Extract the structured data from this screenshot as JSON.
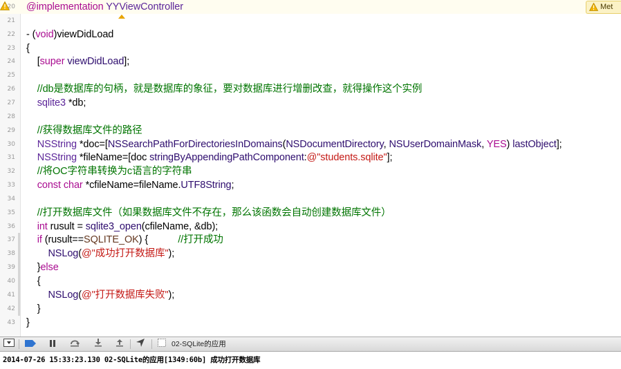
{
  "editor": {
    "issue_badge": {
      "text": "Met",
      "icon": "warning-icon"
    },
    "lines": [
      {
        "n": "20",
        "t": [
          {
            "c": "kw",
            "s": "@implementation"
          },
          {
            "c": "",
            "s": " "
          },
          {
            "c": "ty",
            "s": "YYViewController"
          }
        ]
      },
      {
        "n": "21",
        "t": []
      },
      {
        "n": "22",
        "t": [
          {
            "c": "",
            "s": "- ("
          },
          {
            "c": "kw",
            "s": "void"
          },
          {
            "c": "",
            "s": ")viewDidLoad"
          }
        ]
      },
      {
        "n": "23",
        "t": [
          {
            "c": "",
            "s": "{"
          }
        ]
      },
      {
        "n": "24",
        "t": [
          {
            "c": "",
            "s": "    ["
          },
          {
            "c": "kw",
            "s": "super"
          },
          {
            "c": "",
            "s": " "
          },
          {
            "c": "fn",
            "s": "viewDidLoad"
          },
          {
            "c": "",
            "s": "];"
          }
        ]
      },
      {
        "n": "25",
        "t": []
      },
      {
        "n": "26",
        "t": [
          {
            "c": "cm",
            "s": "    //db是数据库的句柄，就是数据库的象征，要对数据库进行增删改查，就得操作这个实例"
          }
        ]
      },
      {
        "n": "27",
        "t": [
          {
            "c": "",
            "s": "    "
          },
          {
            "c": "ty",
            "s": "sqlite3"
          },
          {
            "c": "",
            "s": " *db;"
          }
        ]
      },
      {
        "n": "28",
        "t": []
      },
      {
        "n": "29",
        "t": [
          {
            "c": "cm",
            "s": "    //获得数据库文件的路径"
          }
        ]
      },
      {
        "n": "30",
        "t": [
          {
            "c": "",
            "s": "    "
          },
          {
            "c": "ty",
            "s": "NSString"
          },
          {
            "c": "",
            "s": " *doc=["
          },
          {
            "c": "fn",
            "s": "NSSearchPathForDirectoriesInDomains"
          },
          {
            "c": "",
            "s": "("
          },
          {
            "c": "fn",
            "s": "NSDocumentDirectory"
          },
          {
            "c": "",
            "s": ", "
          },
          {
            "c": "fn",
            "s": "NSUserDomainMask"
          },
          {
            "c": "",
            "s": ", "
          },
          {
            "c": "kw",
            "s": "YES"
          },
          {
            "c": "",
            "s": ") "
          },
          {
            "c": "fn",
            "s": "lastObject"
          },
          {
            "c": "",
            "s": "];"
          }
        ]
      },
      {
        "n": "31",
        "t": [
          {
            "c": "",
            "s": "    "
          },
          {
            "c": "ty",
            "s": "NSString"
          },
          {
            "c": "",
            "s": " *fileName=[doc "
          },
          {
            "c": "fn",
            "s": "stringByAppendingPathComponent"
          },
          {
            "c": "",
            "s": ":"
          },
          {
            "c": "st",
            "s": "@\"students.sqlite\""
          },
          {
            "c": "",
            "s": "];"
          }
        ]
      },
      {
        "n": "32",
        "t": [
          {
            "c": "cm",
            "s": "    //将OC字符串转换为c语言的字符串"
          }
        ]
      },
      {
        "n": "33",
        "t": [
          {
            "c": "",
            "s": "    "
          },
          {
            "c": "kw",
            "s": "const"
          },
          {
            "c": "",
            "s": " "
          },
          {
            "c": "kw",
            "s": "char"
          },
          {
            "c": "",
            "s": " *cfileName=fileName."
          },
          {
            "c": "fn",
            "s": "UTF8String"
          },
          {
            "c": "",
            "s": ";"
          }
        ]
      },
      {
        "n": "34",
        "t": []
      },
      {
        "n": "35",
        "t": [
          {
            "c": "cm",
            "s": "    //打开数据库文件（如果数据库文件不存在，那么该函数会自动创建数据库文件）"
          }
        ]
      },
      {
        "n": "36",
        "t": [
          {
            "c": "",
            "s": "    "
          },
          {
            "c": "kw",
            "s": "int"
          },
          {
            "c": "",
            "s": " rusult = "
          },
          {
            "c": "fn",
            "s": "sqlite3_open"
          },
          {
            "c": "",
            "s": "(cfileName, &db);"
          }
        ]
      },
      {
        "n": "37",
        "t": [
          {
            "c": "",
            "s": "    "
          },
          {
            "c": "kw",
            "s": "if"
          },
          {
            "c": "",
            "s": " (rusult=="
          },
          {
            "c": "mc",
            "s": "SQLITE_OK"
          },
          {
            "c": "",
            "s": ") {           "
          },
          {
            "c": "cm",
            "s": "//打开成功"
          }
        ]
      },
      {
        "n": "38",
        "t": [
          {
            "c": "",
            "s": "        "
          },
          {
            "c": "fn",
            "s": "NSLog"
          },
          {
            "c": "",
            "s": "("
          },
          {
            "c": "st",
            "s": "@\"成功打开数据库\""
          },
          {
            "c": "",
            "s": ");"
          }
        ]
      },
      {
        "n": "39",
        "t": [
          {
            "c": "",
            "s": "    }"
          },
          {
            "c": "kw",
            "s": "else"
          }
        ]
      },
      {
        "n": "40",
        "t": [
          {
            "c": "",
            "s": "    {"
          }
        ]
      },
      {
        "n": "41",
        "t": [
          {
            "c": "",
            "s": "        "
          },
          {
            "c": "fn",
            "s": "NSLog"
          },
          {
            "c": "",
            "s": "("
          },
          {
            "c": "st",
            "s": "@\"打开数据库失败\""
          },
          {
            "c": "",
            "s": ");"
          }
        ]
      },
      {
        "n": "42",
        "t": [
          {
            "c": "",
            "s": "    }"
          }
        ]
      },
      {
        "n": "43",
        "t": [
          {
            "c": "",
            "s": "}"
          }
        ]
      }
    ]
  },
  "debugbar": {
    "buttons": [
      {
        "name": "toggle-console-button",
        "icon": "console-toggle-icon"
      },
      {
        "name": "breakpoints-button",
        "icon": "breakpoint-icon"
      },
      {
        "name": "pause-button",
        "icon": "pause-icon"
      },
      {
        "name": "step-over-button",
        "icon": "step-over-icon"
      },
      {
        "name": "step-into-button",
        "icon": "step-into-icon"
      },
      {
        "name": "step-out-button",
        "icon": "step-out-icon"
      },
      {
        "name": "simulate-location-button",
        "icon": "location-icon"
      }
    ],
    "thread_label": "02-SQLite的应用"
  },
  "console": {
    "output": "2014-07-26 15:33:23.130 02-SQLite的应用[1349:60b] 成功打开数据库"
  }
}
